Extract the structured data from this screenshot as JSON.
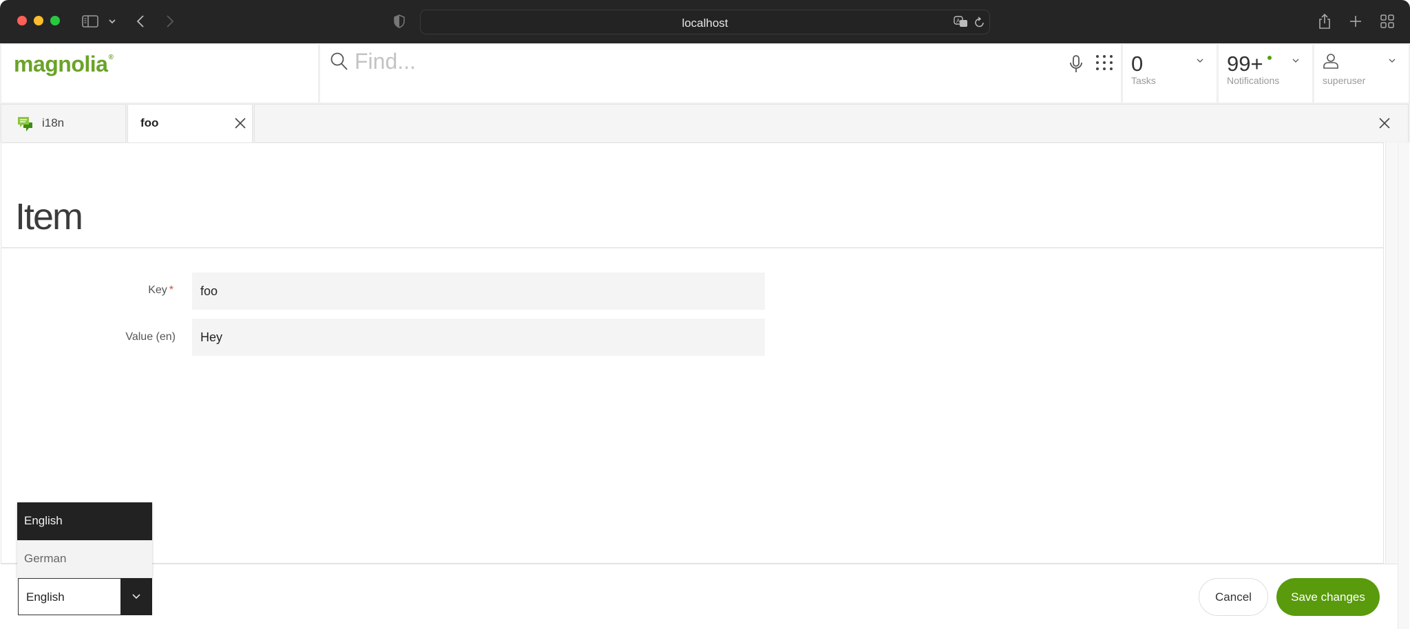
{
  "browser": {
    "url": "localhost",
    "icons": [
      "sidebar-icon",
      "chevron-down-icon",
      "back-icon",
      "forward-icon",
      "shield-icon",
      "translate-icon",
      "reload-icon",
      "share-icon",
      "new-tab-icon",
      "tab-overview-icon"
    ]
  },
  "app": {
    "logo": "magnolia",
    "logo_mark": "®",
    "search": {
      "placeholder": "Find..."
    },
    "tasks": {
      "count": "0",
      "label": "Tasks"
    },
    "notifications": {
      "count": "99+",
      "label": "Notifications",
      "dot_color": "#57a00e"
    },
    "user": {
      "name": "superuser"
    }
  },
  "tabs": [
    {
      "label": "i18n",
      "icon": "chat-bubbles-icon",
      "active": false
    },
    {
      "label": "foo",
      "active": true,
      "closable": true
    }
  ],
  "form": {
    "title": "Item",
    "fields": [
      {
        "label": "Key",
        "required": "*",
        "value": "foo"
      },
      {
        "label": "Value (en)",
        "value": "Hey"
      }
    ]
  },
  "footer": {
    "language": {
      "selected": "English",
      "options": [
        "English",
        "German"
      ]
    },
    "cancel_label": "Cancel",
    "save_label": "Save changes"
  },
  "colors": {
    "brand_green": "#6aa329",
    "save_green": "#599b0c",
    "required_red": "#e0473f"
  }
}
